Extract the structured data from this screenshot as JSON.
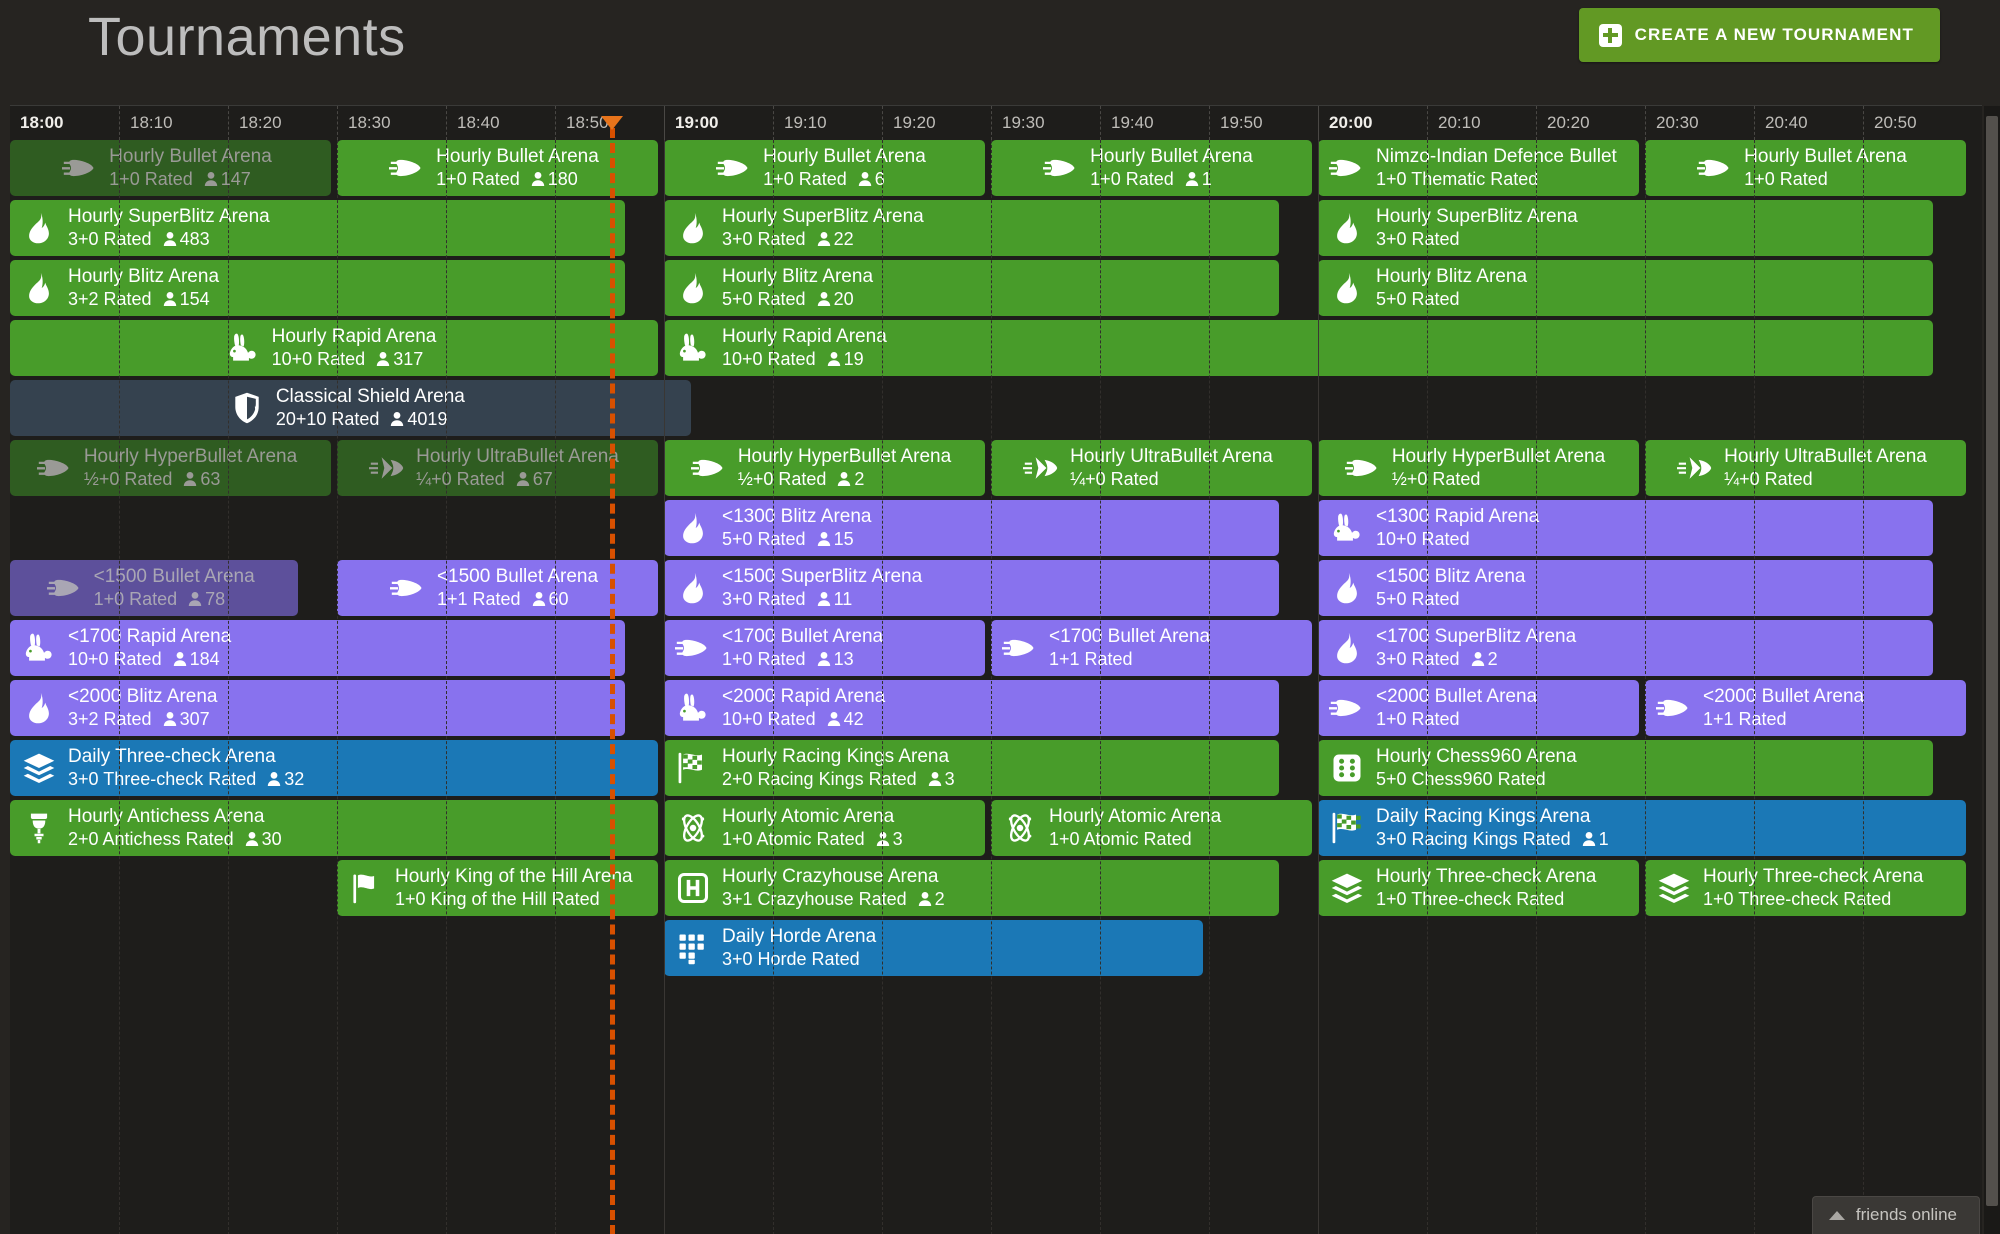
{
  "header": {
    "title": "Tournaments",
    "create_button_label": "CREATE A NEW TOURNAMENT",
    "create_button_color": "#629924"
  },
  "colors": {
    "page_bg": "#262421",
    "board_bg": "#1e1d1b",
    "green": "#489c2a",
    "green_finished": "#2f5c21",
    "purple": "#8872ee",
    "purple_finished": "#5d509b",
    "blue": "#1b78b6",
    "shield": "#35424f",
    "now_marker": "#d85000"
  },
  "timeline": {
    "start_hour": "18:00",
    "minutes_span": 180,
    "now_offset_minutes": 55,
    "ticks": [
      {
        "label": "18:00",
        "hour": true
      },
      {
        "label": "18:10",
        "hour": false
      },
      {
        "label": "18:20",
        "hour": false
      },
      {
        "label": "18:30",
        "hour": false
      },
      {
        "label": "18:40",
        "hour": false
      },
      {
        "label": "18:50",
        "hour": false
      },
      {
        "label": "19:00",
        "hour": true
      },
      {
        "label": "19:10",
        "hour": false
      },
      {
        "label": "19:20",
        "hour": false
      },
      {
        "label": "19:30",
        "hour": false
      },
      {
        "label": "19:40",
        "hour": false
      },
      {
        "label": "19:50",
        "hour": false
      },
      {
        "label": "20:00",
        "hour": true
      },
      {
        "label": "20:10",
        "hour": false
      },
      {
        "label": "20:20",
        "hour": false
      },
      {
        "label": "20:30",
        "hour": false
      },
      {
        "label": "20:40",
        "hour": false
      },
      {
        "label": "20:50",
        "hour": false
      }
    ]
  },
  "lanes": [
    {
      "index": 0,
      "blocks": [
        {
          "name": "Hourly Bullet Arena",
          "meta": "1+0 Rated",
          "players": "147",
          "icon": "bullet-icon",
          "variant": "green",
          "finished": true,
          "start": 0,
          "span": 30,
          "center": true
        },
        {
          "name": "Hourly Bullet Arena",
          "meta": "1+0 Rated",
          "players": "180",
          "icon": "bullet-icon",
          "variant": "green",
          "finished": false,
          "start": 30,
          "span": 30,
          "center": true
        },
        {
          "name": "Hourly Bullet Arena",
          "meta": "1+0 Rated",
          "players": "6",
          "icon": "bullet-icon",
          "variant": "green",
          "finished": false,
          "start": 60,
          "span": 30,
          "center": true
        },
        {
          "name": "Hourly Bullet Arena",
          "meta": "1+0 Rated",
          "players": "1",
          "icon": "bullet-icon",
          "variant": "green",
          "finished": false,
          "start": 90,
          "span": 30,
          "center": true
        },
        {
          "name": "Nimzo-Indian Defence Bullet",
          "meta": "1+0 Thematic Rated",
          "players": "",
          "icon": "bullet-icon",
          "variant": "green",
          "finished": false,
          "start": 120,
          "span": 30,
          "center": false
        },
        {
          "name": "Hourly Bullet Arena",
          "meta": "1+0 Rated",
          "players": "",
          "icon": "bullet-icon",
          "variant": "green",
          "finished": false,
          "start": 150,
          "span": 30,
          "center": true
        }
      ]
    },
    {
      "index": 1,
      "blocks": [
        {
          "name": "Hourly SuperBlitz Arena",
          "meta": "3+0 Rated",
          "players": "483",
          "icon": "flame-icon",
          "variant": "green",
          "finished": false,
          "start": 0,
          "span": 57,
          "center": false
        },
        {
          "name": "Hourly SuperBlitz Arena",
          "meta": "3+0 Rated",
          "players": "22",
          "icon": "flame-icon",
          "variant": "green",
          "finished": false,
          "start": 60,
          "span": 57,
          "center": false
        },
        {
          "name": "Hourly SuperBlitz Arena",
          "meta": "3+0 Rated",
          "players": "",
          "icon": "flame-icon",
          "variant": "green",
          "finished": false,
          "start": 120,
          "span": 57,
          "center": false
        }
      ]
    },
    {
      "index": 2,
      "blocks": [
        {
          "name": "Hourly Blitz Arena",
          "meta": "3+2 Rated",
          "players": "154",
          "icon": "flame-icon",
          "variant": "green",
          "finished": false,
          "start": 0,
          "span": 57,
          "center": false
        },
        {
          "name": "Hourly Blitz Arena",
          "meta": "5+0 Rated",
          "players": "20",
          "icon": "flame-icon",
          "variant": "green",
          "finished": false,
          "start": 60,
          "span": 57,
          "center": false
        },
        {
          "name": "Hourly Blitz Arena",
          "meta": "5+0 Rated",
          "players": "",
          "icon": "flame-icon",
          "variant": "green",
          "finished": false,
          "start": 120,
          "span": 57,
          "center": false
        }
      ]
    },
    {
      "index": 3,
      "blocks": [
        {
          "name": "Hourly Rapid Arena",
          "meta": "10+0 Rated",
          "players": "317",
          "icon": "rabbit-icon",
          "variant": "green",
          "finished": false,
          "start": 0,
          "span": 60,
          "center": true
        },
        {
          "name": "Hourly Rapid Arena",
          "meta": "10+0 Rated",
          "players": "19",
          "icon": "rabbit-icon",
          "variant": "green",
          "finished": false,
          "start": 60,
          "span": 117,
          "center": false
        }
      ]
    },
    {
      "index": 4,
      "blocks": [
        {
          "name": "Classical Shield Arena",
          "meta": "20+10 Rated",
          "players": "4019",
          "icon": "shield-icon",
          "variant": "shield",
          "finished": false,
          "start": 0,
          "span": 63,
          "center": true
        }
      ]
    },
    {
      "index": 5,
      "blocks": [
        {
          "name": "Hourly HyperBullet Arena",
          "meta": "½+0 Rated",
          "players": "63",
          "icon": "bullet-icon",
          "variant": "green",
          "finished": true,
          "start": 0,
          "span": 30,
          "center": true
        },
        {
          "name": "Hourly UltraBullet Arena",
          "meta": "¼+0 Rated",
          "players": "67",
          "icon": "ultrabullet-icon",
          "variant": "green",
          "finished": true,
          "start": 30,
          "span": 30,
          "center": true
        },
        {
          "name": "Hourly HyperBullet Arena",
          "meta": "½+0 Rated",
          "players": "2",
          "icon": "bullet-icon",
          "variant": "green",
          "finished": false,
          "start": 60,
          "span": 30,
          "center": true
        },
        {
          "name": "Hourly UltraBullet Arena",
          "meta": "¼+0 Rated",
          "players": "",
          "icon": "ultrabullet-icon",
          "variant": "green",
          "finished": false,
          "start": 90,
          "span": 30,
          "center": true
        },
        {
          "name": "Hourly HyperBullet Arena",
          "meta": "½+0 Rated",
          "players": "",
          "icon": "bullet-icon",
          "variant": "green",
          "finished": false,
          "start": 120,
          "span": 30,
          "center": true
        },
        {
          "name": "Hourly UltraBullet Arena",
          "meta": "¼+0 Rated",
          "players": "",
          "icon": "ultrabullet-icon",
          "variant": "green",
          "finished": false,
          "start": 150,
          "span": 30,
          "center": true
        }
      ]
    },
    {
      "index": 6,
      "blocks": [
        {
          "name": "<1300 Blitz Arena",
          "meta": "5+0 Rated",
          "players": "15",
          "icon": "flame-icon",
          "variant": "purple",
          "finished": false,
          "start": 60,
          "span": 57,
          "center": false
        },
        {
          "name": "<1300 Rapid Arena",
          "meta": "10+0 Rated",
          "players": "",
          "icon": "rabbit-icon",
          "variant": "purple",
          "finished": false,
          "start": 120,
          "span": 57,
          "center": false
        }
      ]
    },
    {
      "index": 7,
      "blocks": [
        {
          "name": "<1500 Bullet Arena",
          "meta": "1+0 Rated",
          "players": "78",
          "icon": "bullet-icon",
          "variant": "purple",
          "finished": true,
          "start": 0,
          "span": 27,
          "center": true
        },
        {
          "name": "<1500 Bullet Arena",
          "meta": "1+1 Rated",
          "players": "60",
          "icon": "bullet-icon",
          "variant": "purple",
          "finished": false,
          "start": 30,
          "span": 30,
          "center": true
        },
        {
          "name": "<1500 SuperBlitz Arena",
          "meta": "3+0 Rated",
          "players": "11",
          "icon": "flame-icon",
          "variant": "purple",
          "finished": false,
          "start": 60,
          "span": 57,
          "center": false
        },
        {
          "name": "<1500 Blitz Arena",
          "meta": "5+0 Rated",
          "players": "",
          "icon": "flame-icon",
          "variant": "purple",
          "finished": false,
          "start": 120,
          "span": 57,
          "center": false
        }
      ]
    },
    {
      "index": 8,
      "blocks": [
        {
          "name": "<1700 Rapid Arena",
          "meta": "10+0 Rated",
          "players": "184",
          "icon": "rabbit-icon",
          "variant": "purple",
          "finished": false,
          "start": 0,
          "span": 57,
          "center": false
        },
        {
          "name": "<1700 Bullet Arena",
          "meta": "1+0 Rated",
          "players": "13",
          "icon": "bullet-icon",
          "variant": "purple",
          "finished": false,
          "start": 60,
          "span": 30,
          "center": false
        },
        {
          "name": "<1700 Bullet Arena",
          "meta": "1+1 Rated",
          "players": "",
          "icon": "bullet-icon",
          "variant": "purple",
          "finished": false,
          "start": 90,
          "span": 30,
          "center": false
        },
        {
          "name": "<1700 SuperBlitz Arena",
          "meta": "3+0 Rated",
          "players": "2",
          "icon": "flame-icon",
          "variant": "purple",
          "finished": false,
          "start": 120,
          "span": 57,
          "center": false
        }
      ]
    },
    {
      "index": 9,
      "blocks": [
        {
          "name": "<2000 Blitz Arena",
          "meta": "3+2 Rated",
          "players": "307",
          "icon": "flame-icon",
          "variant": "purple",
          "finished": false,
          "start": 0,
          "span": 57,
          "center": false
        },
        {
          "name": "<2000 Rapid Arena",
          "meta": "10+0 Rated",
          "players": "42",
          "icon": "rabbit-icon",
          "variant": "purple",
          "finished": false,
          "start": 60,
          "span": 57,
          "center": false
        },
        {
          "name": "<2000 Bullet Arena",
          "meta": "1+0 Rated",
          "players": "",
          "icon": "bullet-icon",
          "variant": "purple",
          "finished": false,
          "start": 120,
          "span": 30,
          "center": false
        },
        {
          "name": "<2000 Bullet Arena",
          "meta": "1+1 Rated",
          "players": "",
          "icon": "bullet-icon",
          "variant": "purple",
          "finished": false,
          "start": 150,
          "span": 30,
          "center": false
        }
      ]
    },
    {
      "index": 10,
      "blocks": [
        {
          "name": "Daily Three-check Arena",
          "meta": "3+0 Three-check Rated",
          "players": "32",
          "icon": "layers-icon",
          "variant": "blue",
          "finished": false,
          "start": 0,
          "span": 60,
          "center": false
        },
        {
          "name": "Hourly Racing Kings Arena",
          "meta": "2+0 Racing Kings Rated",
          "players": "3",
          "icon": "racing-flag-icon",
          "variant": "green",
          "finished": false,
          "start": 60,
          "span": 57,
          "center": false
        },
        {
          "name": "Hourly Chess960 Arena",
          "meta": "5+0 Chess960 Rated",
          "players": "",
          "icon": "dice-icon",
          "variant": "green",
          "finished": false,
          "start": 120,
          "span": 57,
          "center": false
        }
      ]
    },
    {
      "index": 11,
      "blocks": [
        {
          "name": "Hourly Antichess Arena",
          "meta": "2+0 Antichess Rated",
          "players": "30",
          "icon": "antichess-icon",
          "variant": "green",
          "finished": false,
          "start": 0,
          "span": 60,
          "center": false
        },
        {
          "name": "Hourly Atomic Arena",
          "meta": "1+0 Atomic Rated",
          "players": "3",
          "icon": "atom-icon",
          "variant": "green",
          "finished": false,
          "start": 60,
          "span": 30,
          "center": false
        },
        {
          "name": "Hourly Atomic Arena",
          "meta": "1+0 Atomic Rated",
          "players": "",
          "icon": "atom-icon",
          "variant": "green",
          "finished": false,
          "start": 90,
          "span": 30,
          "center": false
        },
        {
          "name": "Daily Racing Kings Arena",
          "meta": "3+0 Racing Kings Rated",
          "players": "1",
          "icon": "racing-flag-icon",
          "variant": "blue",
          "finished": false,
          "start": 120,
          "span": 60,
          "center": false
        }
      ]
    },
    {
      "index": 12,
      "blocks": [
        {
          "name": "Hourly King of the Hill Arena",
          "meta": "1+0 King of the Hill Rated",
          "players": "",
          "icon": "flag-icon",
          "variant": "green",
          "finished": false,
          "start": 30,
          "span": 30,
          "center": false
        },
        {
          "name": "Hourly Crazyhouse Arena",
          "meta": "3+1 Crazyhouse Rated",
          "players": "2",
          "icon": "crazyhouse-icon",
          "variant": "green",
          "finished": false,
          "start": 60,
          "span": 57,
          "center": false
        },
        {
          "name": "Hourly Three-check Arena",
          "meta": "1+0 Three-check Rated",
          "players": "",
          "icon": "layers-icon",
          "variant": "green",
          "finished": false,
          "start": 120,
          "span": 30,
          "center": false
        },
        {
          "name": "Hourly Three-check Arena",
          "meta": "1+0 Three-check Rated",
          "players": "",
          "icon": "layers-icon",
          "variant": "green",
          "finished": false,
          "start": 150,
          "span": 30,
          "center": false
        }
      ]
    },
    {
      "index": 13,
      "blocks": [
        {
          "name": "Daily Horde Arena",
          "meta": "3+0 Horde Rated",
          "players": "",
          "icon": "horde-icon",
          "variant": "blue",
          "finished": false,
          "start": 60,
          "span": 50,
          "center": false
        }
      ]
    }
  ],
  "footer": {
    "friends_label": "friends online"
  }
}
